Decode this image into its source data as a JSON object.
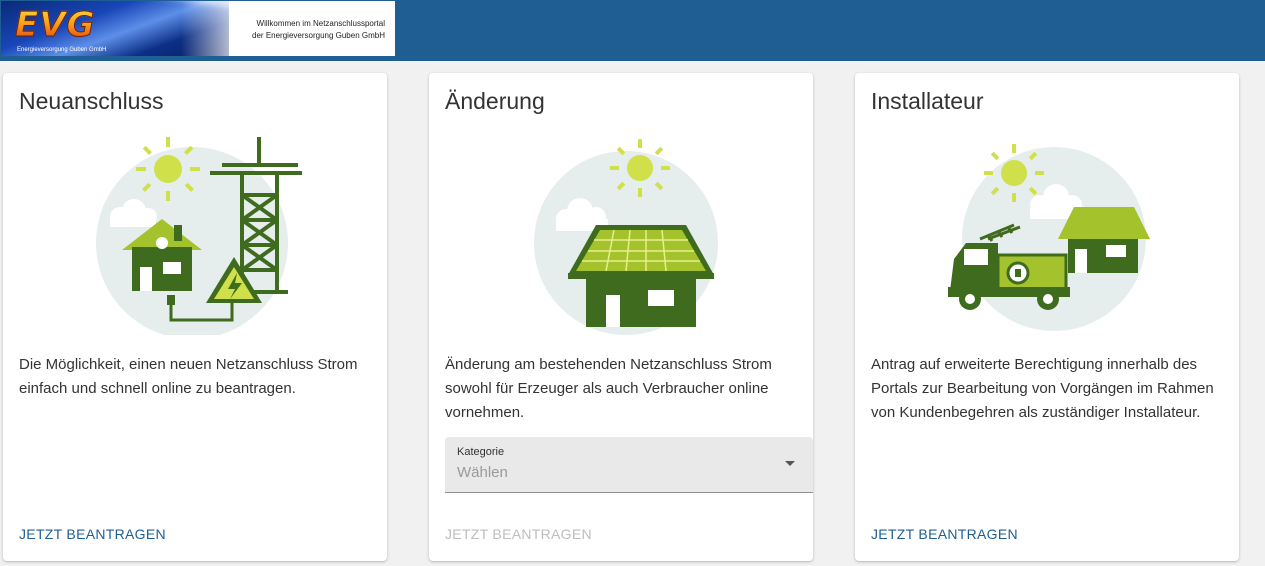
{
  "header": {
    "logo_text": "EVG",
    "logo_subtitle": "Energieversorgung Guben GmbH",
    "welcome_line1": "Willkommen im Netzanschlussportal",
    "welcome_line2": "der Energieversorgung Guben GmbH"
  },
  "cards": [
    {
      "title": "Neuanschluss",
      "illustration": "house-power-tower-icon",
      "description": "Die Möglichkeit, einen neuen Netzanschluss Strom einfach und schnell online zu beantragen.",
      "action": "JETZT BEANTRAGEN",
      "action_enabled": true
    },
    {
      "title": "Änderung",
      "illustration": "solar-house-icon",
      "description": "Änderung am bestehenden Netzanschluss Strom sowohl für Erzeuger als auch Verbraucher online vornehmen.",
      "select": {
        "label": "Kategorie",
        "placeholder": "Wählen"
      },
      "action": "JETZT BEANTRAGEN",
      "action_enabled": false
    },
    {
      "title": "Installateur",
      "illustration": "installer-truck-icon",
      "description": "Antrag auf erweiterte Berechtigung innerhalb des Portals zur Bearbeitung von Vorgängen im Rahmen von Kundenbegehren als zuständiger Installateur.",
      "action": "JETZT BEANTRAGEN",
      "action_enabled": true
    }
  ],
  "colors": {
    "header_bar": "#1f5e93",
    "link": "#1f5e93",
    "disabled_link": "#bdbdbd",
    "illustration_dark_green": "#3f6b1e",
    "illustration_light_green": "#a3c22c",
    "illustration_sun": "#cfe04a",
    "illustration_circle": "#e6eded"
  }
}
